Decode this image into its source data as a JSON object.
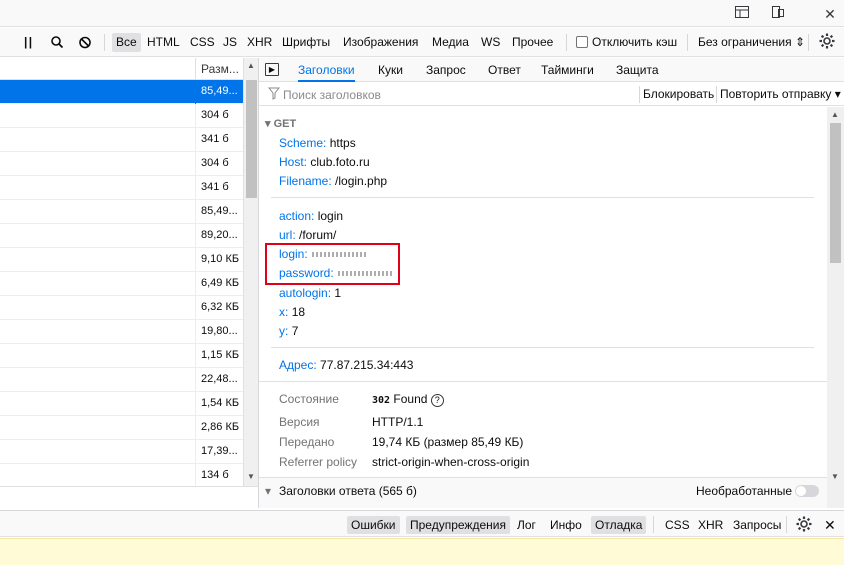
{
  "window_buttons": {
    "dock_icon": "dock-icon",
    "popout_icon": "popout-icon",
    "close_label": "✕"
  },
  "filter_toolbar": {
    "pause_icon": "pause-icon",
    "search_icon": "search-icon",
    "clear_icon": "clear-icon",
    "types": [
      "Все",
      "HTML",
      "CSS",
      "JS",
      "XHR",
      "Шрифты",
      "Изображения",
      "Медиа",
      "WS",
      "Прочее"
    ],
    "disable_cache_label": "Отключить кэш",
    "throttle_label": "Без ограничения ⇕",
    "settings_icon": "gear-icon"
  },
  "request_list": {
    "size_header": "Разм...",
    "rows": [
      "85,49...",
      "304 б",
      "341 б",
      "304 б",
      "341 б",
      "85,49...",
      "89,20...",
      "9,10 КБ",
      "6,49 КБ",
      "6,32 КБ",
      "19,80...",
      "1,15 КБ",
      "22,48...",
      "1,54 КБ",
      "2,86 КБ",
      "17,39...",
      "134 б"
    ],
    "selected_index": 0
  },
  "detail_tabs": {
    "panel_icon": "panel-icon",
    "tabs": [
      "Заголовки",
      "Куки",
      "Запрос",
      "Ответ",
      "Тайминги",
      "Защита"
    ],
    "active": 0
  },
  "headers_toolbar": {
    "filter_icon": "filter-icon",
    "search_placeholder": "Поиск заголовков",
    "block_label": "Блокировать",
    "resend_label": "Повторить отправку ▾"
  },
  "request": {
    "method": "GET",
    "scheme": {
      "key": "Scheme:",
      "value": "https"
    },
    "host": {
      "key": "Host:",
      "value": "club.foto.ru"
    },
    "filename": {
      "key": "Filename:",
      "value": "/login.php"
    },
    "params": [
      {
        "key": "action:",
        "value": "login"
      },
      {
        "key": "url:",
        "value": "/forum/"
      },
      {
        "key": "login:",
        "value": ""
      },
      {
        "key": "password:",
        "value": ""
      },
      {
        "key": "autologin:",
        "value": "1"
      },
      {
        "key": "x:",
        "value": "18"
      },
      {
        "key": "y:",
        "value": "7"
      }
    ],
    "address": {
      "key": "Адрес:",
      "value": "77.87.215.34:443"
    }
  },
  "status": {
    "state": {
      "key": "Состояние",
      "code": "302",
      "text": "Found"
    },
    "version": {
      "key": "Версия",
      "value": "HTTP/1.1"
    },
    "transferred": {
      "key": "Передано",
      "value": "19,74 КБ (размер 85,49 КБ)"
    },
    "referrer": {
      "key": "Referrer policy",
      "value": "strict-origin-when-cross-origin"
    }
  },
  "response_headers": {
    "title": "Заголовки ответа (565 б)",
    "raw_label": "Необработанные"
  },
  "console_bar": {
    "filters": [
      "Ошибки",
      "Предупреждения",
      "Лог",
      "Инфо",
      "Отладка"
    ],
    "extras": [
      "CSS",
      "XHR",
      "Запросы"
    ],
    "settings_icon": "gear-icon",
    "close_label": "✕"
  }
}
